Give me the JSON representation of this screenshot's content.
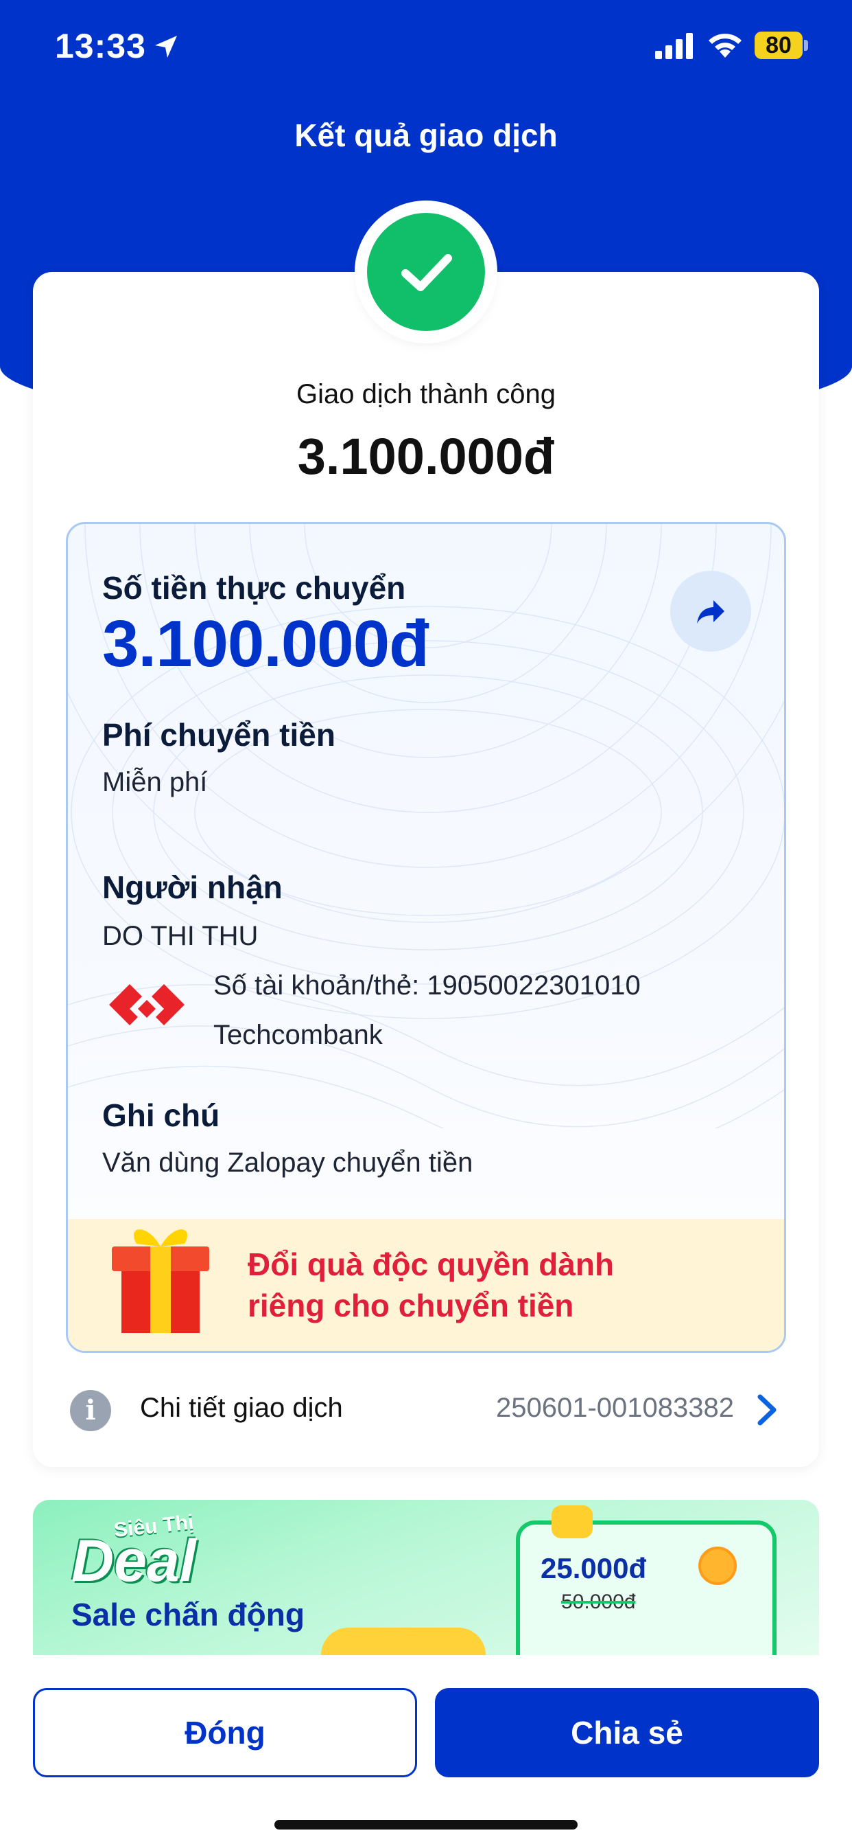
{
  "status_bar": {
    "time": "13:33",
    "battery": "80"
  },
  "header": {
    "title": "Kết quả giao dịch"
  },
  "result": {
    "status": "Giao dịch thành công",
    "amount": "3.100.000đ"
  },
  "details": {
    "actual_amount_label": "Số tiền thực chuyển",
    "actual_amount": "3.100.000đ",
    "fee_label": "Phí chuyển tiền",
    "fee_value": "Miễn phí",
    "recipient_label": "Người nhận",
    "recipient_name": "DO THI THU",
    "account_line": "Số tài khoản/thẻ: 19050022301010",
    "bank_name": "Techcombank",
    "note_label": "Ghi chú",
    "note_value": "Văn dùng Zalopay chuyển tiền"
  },
  "promo": {
    "line1": "Đổi quà độc quyền dành",
    "line2": "riêng cho chuyển tiền"
  },
  "transaction": {
    "label": "Chi tiết giao dịch",
    "id": "250601-001083382"
  },
  "banner": {
    "logo_top": "Siêu Thị",
    "logo": "Deal",
    "subtitle": "Sale chấn động",
    "price": "25.000đ",
    "old_price": "50.000đ"
  },
  "actions": {
    "close_label": "Đóng",
    "share_label": "Chia sẻ"
  },
  "colors": {
    "primary": "#0033c9",
    "success": "#11bf6a",
    "promo_text": "#e0203a",
    "promo_bg": "#fff5d6"
  }
}
